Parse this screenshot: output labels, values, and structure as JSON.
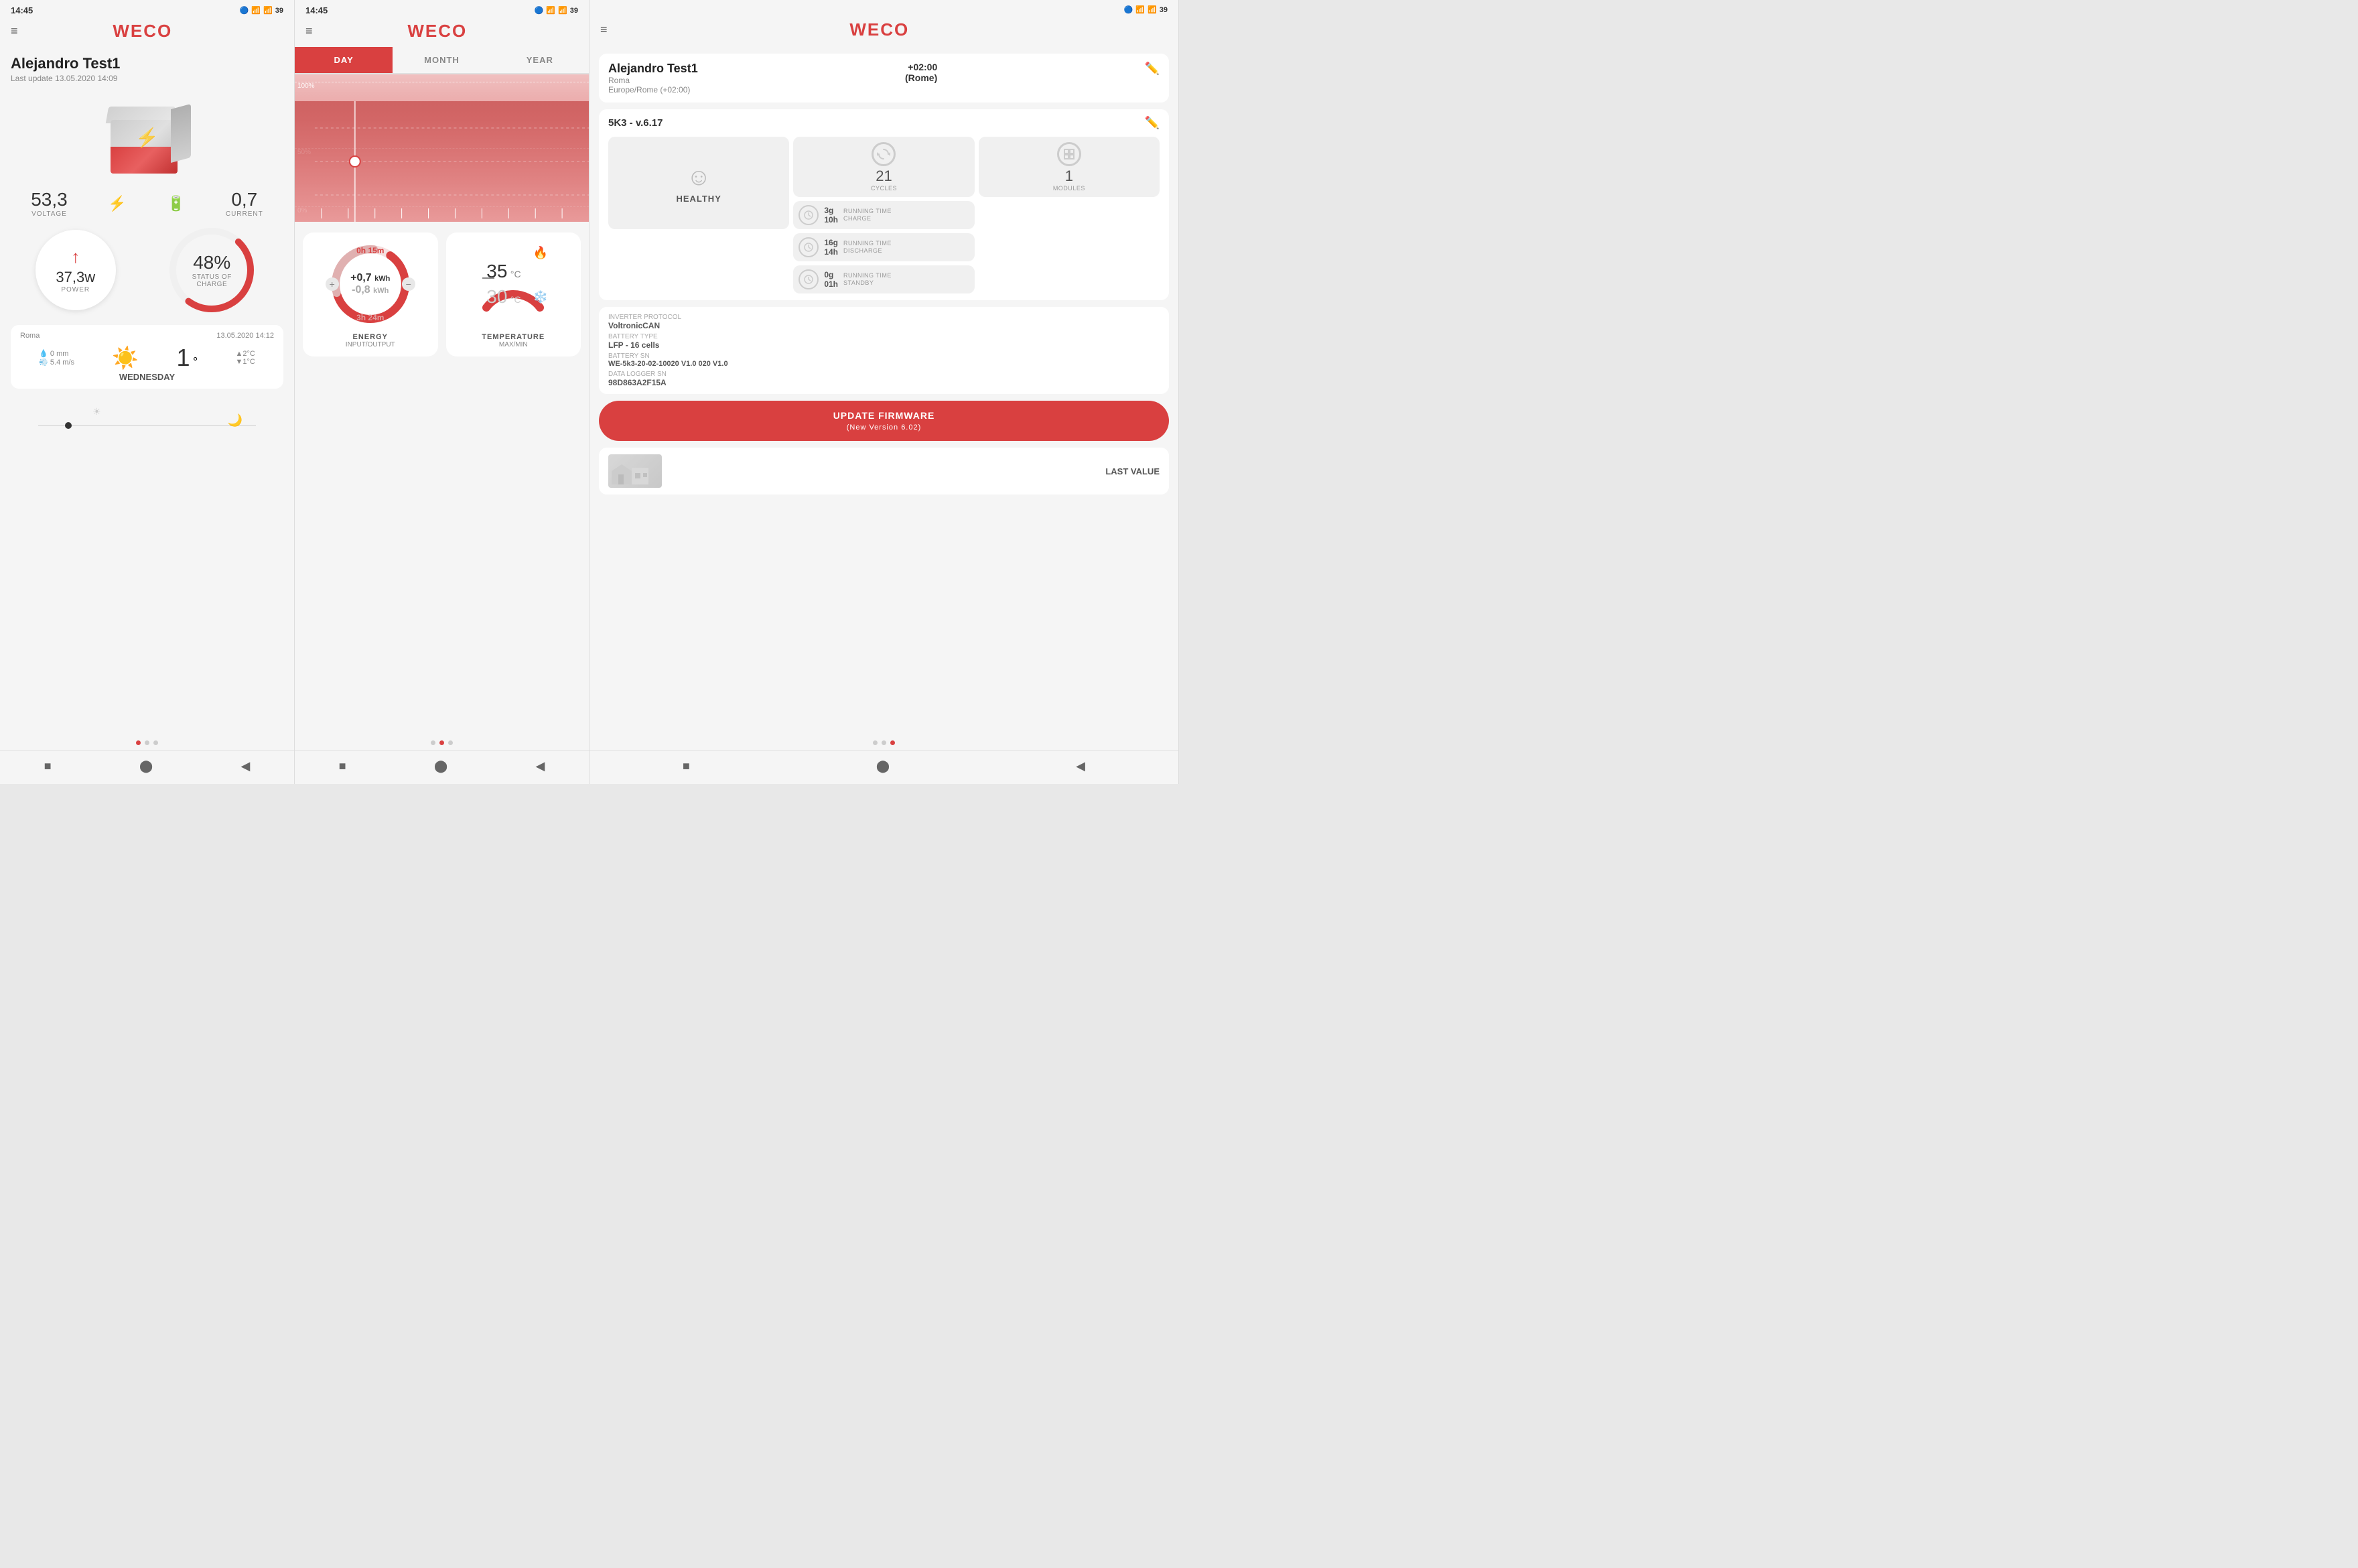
{
  "panel1": {
    "statusbar": {
      "time": "14:45",
      "icons": "🔵 📶 📶 39"
    },
    "topbar": {
      "menu": "≡",
      "logo": "WECO"
    },
    "title": "Alejandro Test1",
    "subtitle": "Last update 13.05.2020 14:09",
    "voltage_label": "VOLTAGE",
    "voltage_value": "53,3",
    "current_label": "CURRENT",
    "current_value": "0,7",
    "power_value": "37,3w",
    "power_label": "POWER",
    "charge_percent": "48%",
    "charge_label1": "STATUS OF",
    "charge_label2": "CHARGE",
    "weather": {
      "location": "Roma",
      "date": "13.05.2020 14:12",
      "rain": "0 mm",
      "wind": "5.4 m/s",
      "temp": "1",
      "temp_unit": "°",
      "high": "▲2°C",
      "low": "▼1°C",
      "day": "WEDNESDAY"
    },
    "dots": [
      "active",
      "inactive",
      "inactive"
    ],
    "nav": [
      "■",
      "⬤",
      "◀"
    ]
  },
  "panel2": {
    "statusbar": {
      "time": "14:45",
      "icons": "🔵 📶 📶 39"
    },
    "topbar": {
      "menu": "≡",
      "logo": "WECO"
    },
    "tabs": [
      {
        "label": "DAY",
        "active": true
      },
      {
        "label": "MONTH",
        "active": false
      },
      {
        "label": "YEAR",
        "active": false
      }
    ],
    "chart": {
      "y_labels": [
        "100%",
        "50%",
        "0%"
      ]
    },
    "energy": {
      "time_top": "0h 15m",
      "kwh_pos": "+0,7",
      "kwh_pos_unit": "kWh",
      "kwh_neg": "-0,8",
      "kwh_neg_unit": "kWh",
      "time_bot": "3h 24m",
      "title": "ENERGY",
      "subtitle": "INPUT/OUTPUT"
    },
    "temperature": {
      "max": "35",
      "max_unit": "°C",
      "min": "30",
      "min_unit": "°C",
      "title": "TEMPERATURE",
      "subtitle": "MAX/MIN"
    },
    "dots": [
      "inactive",
      "active",
      "inactive"
    ],
    "nav": [
      "■",
      "⬤",
      "◀"
    ]
  },
  "panel3": {
    "statusbar": {
      "icons": "🔵 📶 📶 39"
    },
    "topbar": {
      "menu": "≡",
      "logo": "WECO"
    },
    "device": {
      "name": "Alejandro Test1",
      "location": "Roma",
      "tz": "Europe/Rome (+02:00)",
      "offset": "+02:00",
      "offset_city": "(Rome)"
    },
    "system": {
      "id": "5K3 - v.6.17",
      "healthy_label": "HEALTHY",
      "cycles_value": "21",
      "cycles_label": "CYCLES",
      "modules_value": "1",
      "modules_label": "MODULES",
      "charge_time": "3g\n10h",
      "charge_label": "RUNNING TIME\nCHARGE",
      "inverter_label": "INVERTER PROTOCOL",
      "inverter_value": "VoltronicCAN",
      "battery_type_label": "BATTERY TYPE",
      "battery_type_value": "LFP - 16 cells",
      "battery_sn_label": "BATTERY SN",
      "battery_sn_value": "WE-5k3-20-02-10020 V1.0 020 V1.0",
      "data_logger_label": "DATA LOGGER SN",
      "data_logger_value": "98D863A2F15A",
      "discharge_time": "16g\n14h",
      "discharge_label": "RUNNING TIME\nDISCHARGE",
      "standby_time": "0g\n01h",
      "standby_label": "RUNNING TIME\nSTANDBY"
    },
    "update_btn": "UPDATE FIRMWARE",
    "update_sub": "(New Version 6.02)",
    "last_value": "LAST VALUE",
    "dots": [
      "inactive",
      "inactive",
      "active"
    ],
    "nav": [
      "■",
      "⬤",
      "◀"
    ]
  }
}
